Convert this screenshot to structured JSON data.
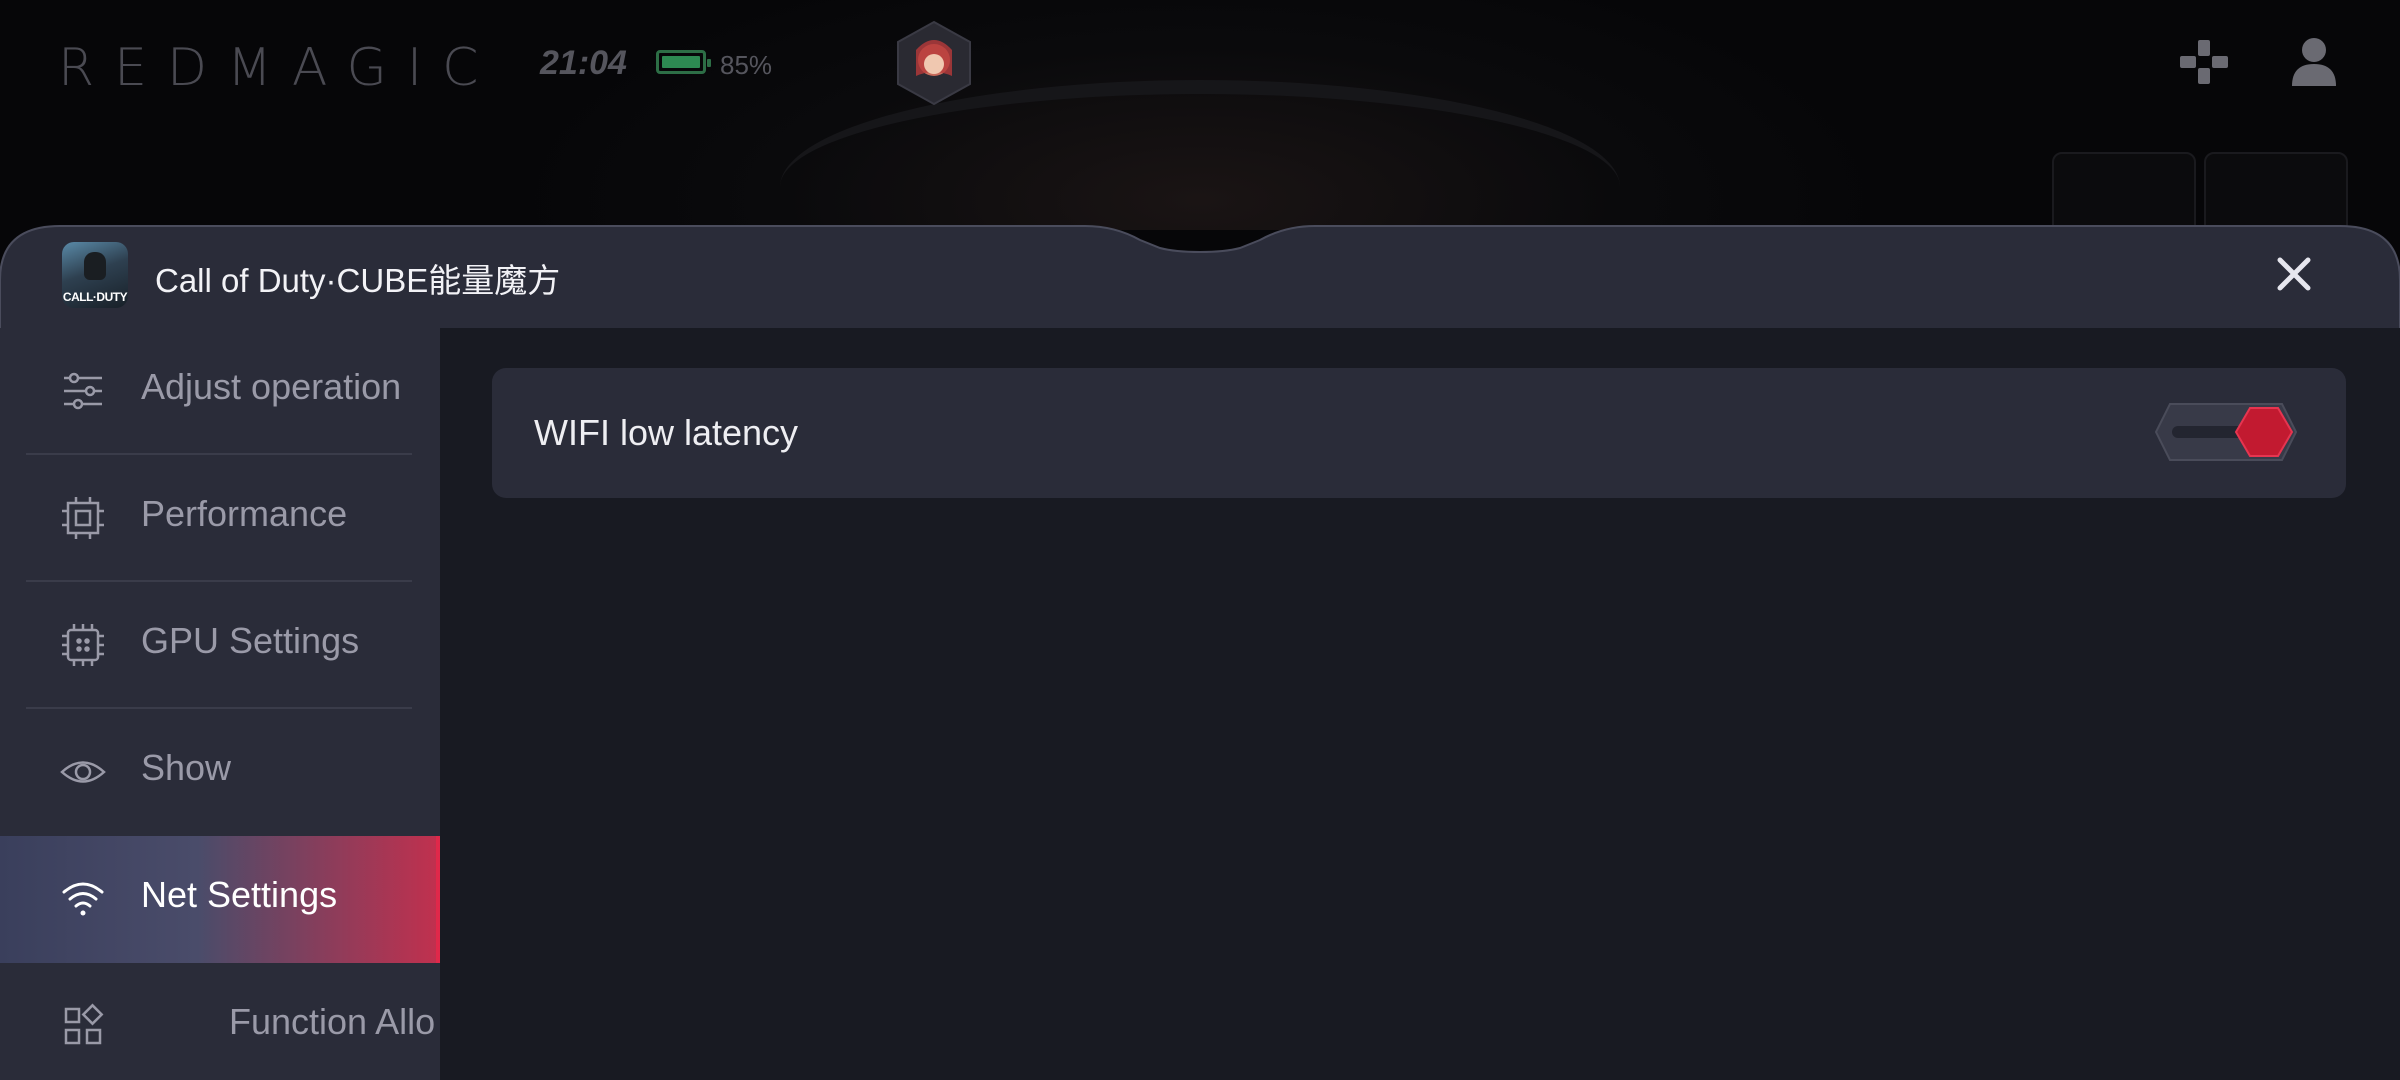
{
  "topbar": {
    "brand": "REDMAGIC",
    "time": "21:04",
    "battery_percent": "85%",
    "battery_level": 0.85
  },
  "panel": {
    "app_title": "Call of Duty·CUBE能量魔方",
    "app_icon_caption": "CALL·DUTY"
  },
  "sidebar": {
    "items": [
      {
        "label": "Adjust operation",
        "icon": "sliders-icon"
      },
      {
        "label": "Performance",
        "icon": "processor-icon"
      },
      {
        "label": "GPU Settings",
        "icon": "chip-icon"
      },
      {
        "label": "Show",
        "icon": "eye-icon"
      },
      {
        "label": "Net Settings",
        "icon": "wifi-icon",
        "active": true
      },
      {
        "label": "Function Allo",
        "icon": "grid-icon"
      }
    ]
  },
  "content": {
    "settings": [
      {
        "label": "WIFI low latency",
        "enabled": true
      }
    ]
  },
  "colors": {
    "accent": "#e0284a",
    "sidebar_bg": "#2a2c39",
    "content_bg": "#181a22"
  }
}
